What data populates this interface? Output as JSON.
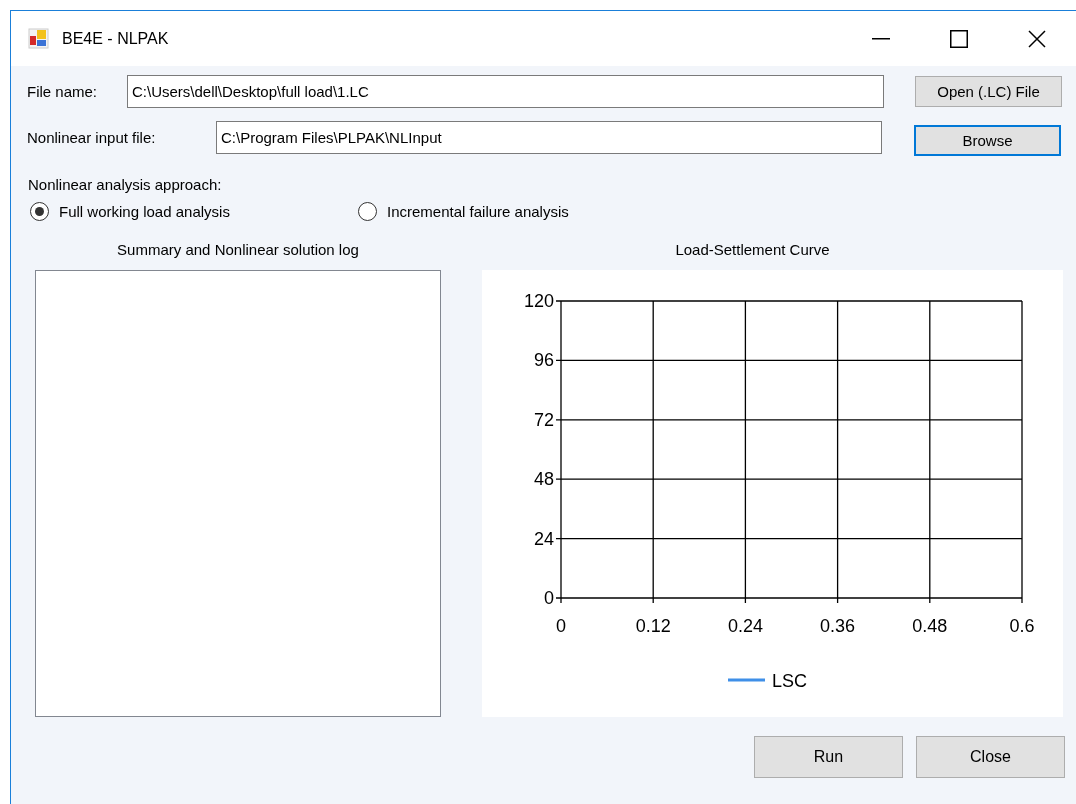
{
  "window": {
    "title": "BE4E - NLPAK"
  },
  "file_rows": [
    {
      "label": "File name:",
      "value": "C:\\Users\\dell\\Desktop\\full load\\1.LC",
      "button": "Open (.LC) File",
      "focused": false
    },
    {
      "label": "Nonlinear input file:",
      "value": "C:\\Program Files\\PLPAK\\NLInput",
      "button": "Browse",
      "focused": true
    }
  ],
  "approach": {
    "label": "Nonlinear analysis approach:",
    "options": [
      {
        "label": "Full working load analysis",
        "selected": true
      },
      {
        "label": "Incremental failure analysis",
        "selected": false
      }
    ]
  },
  "log": {
    "title": "Summary and Nonlinear solution log"
  },
  "chart": {
    "title": "Load-Settlement Curve",
    "chart_data": {
      "type": "line",
      "categories": [
        "0",
        "0.12",
        "0.24",
        "0.36",
        "0.48",
        "0.6"
      ],
      "ylim": [
        0,
        120
      ],
      "yticks": [
        0,
        24,
        48,
        72,
        96,
        120
      ],
      "grid": true,
      "series": [
        {
          "name": "LSC",
          "color": "#3f8fe8",
          "values": [
            null,
            null,
            null,
            null,
            null,
            null
          ]
        }
      ]
    }
  },
  "buttons": [
    "Run",
    "Close"
  ]
}
